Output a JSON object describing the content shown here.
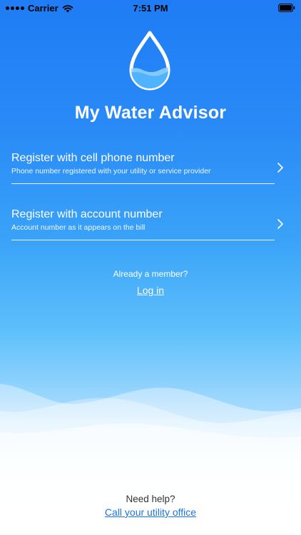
{
  "status_bar": {
    "carrier": "Carrier",
    "time": "7:51 PM"
  },
  "app": {
    "title": "My Water Advisor"
  },
  "register": {
    "phone": {
      "title": "Register with cell phone number",
      "subtitle": "Phone number registered with your utility or service provider"
    },
    "account": {
      "title": "Register with account number",
      "subtitle": "Account number as it appears on the bill"
    }
  },
  "member": {
    "prompt": "Already a member?",
    "login_label": "Log in"
  },
  "help": {
    "prompt": "Need help?",
    "call_label": "Call your utility office"
  },
  "icons": {
    "logo": "water-drop-icon",
    "chevron": "chevron-right-icon"
  },
  "colors": {
    "gradient_top": "#1f7cf5",
    "gradient_bottom": "#ffffff",
    "link": "#1a73e8"
  }
}
